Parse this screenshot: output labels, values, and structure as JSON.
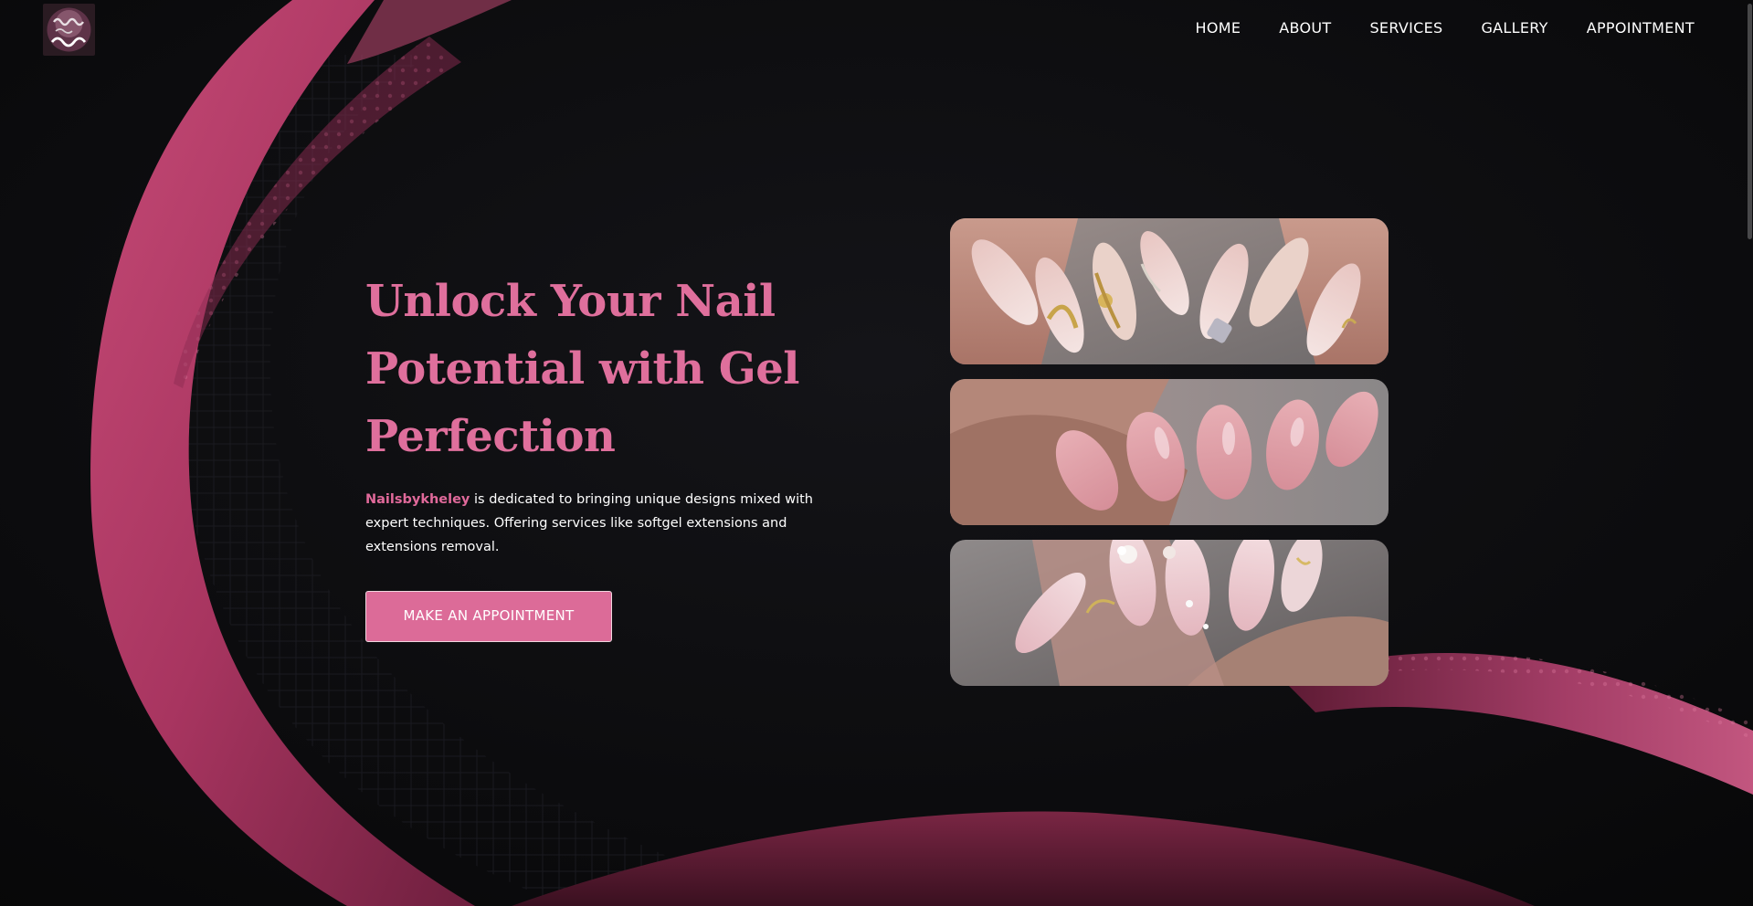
{
  "brand": {
    "logo_icon": "nails-by-kheley-logo",
    "name": "Nailsbykheley"
  },
  "nav": {
    "items": [
      {
        "label": "HOME"
      },
      {
        "label": "ABOUT"
      },
      {
        "label": "SERVICES"
      },
      {
        "label": "GALLERY"
      },
      {
        "label": "APPOINTMENT"
      }
    ]
  },
  "hero": {
    "title_line1": "Unlock Your Nail",
    "title_line2": "Potential with Gel",
    "title_line3": "Perfection",
    "description_brand": "Nailsbykheley",
    "description_rest": " is dedicated to bringing unique designs mixed with expert techniques. Offering services like softgel extensions and extensions removal.",
    "cta_label": "MAKE AN APPOINTMENT"
  },
  "gallery": {
    "photos": [
      {
        "subject": "nail-art-gold-chrome-photo"
      },
      {
        "subject": "pink-almond-nails-photo"
      },
      {
        "subject": "3d-flower-nail-art-photo"
      }
    ]
  },
  "colors": {
    "accent_pink": "#df6f9c",
    "button_pink": "#dc6b98",
    "background": "#0a0a0c",
    "wave_pink": "#b83d68"
  }
}
